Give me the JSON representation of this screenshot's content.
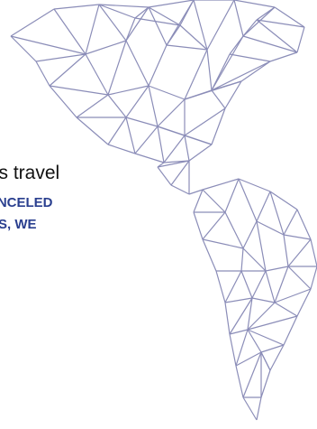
{
  "text": {
    "line1": "ss travel",
    "line2": "ANCELED",
    "line3": "PS, WE"
  },
  "colors": {
    "line_color": "#8b8db8",
    "accent_text": "#2a3f8f",
    "body_text": "#111111"
  }
}
